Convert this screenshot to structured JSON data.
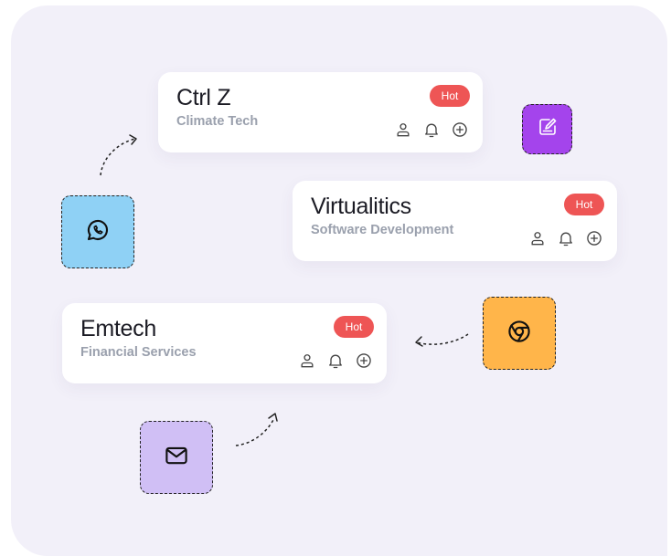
{
  "cards": [
    {
      "title": "Ctrl Z",
      "subtitle": "Climate Tech",
      "badge": "Hot",
      "actions": [
        "user-icon",
        "bell-icon",
        "plus-circle-icon"
      ]
    },
    {
      "title": "Virtualitics",
      "subtitle": "Software Development",
      "badge": "Hot",
      "actions": [
        "user-icon",
        "bell-icon",
        "plus-circle-icon"
      ]
    },
    {
      "title": "Emtech",
      "subtitle": "Financial Services",
      "badge": "Hot",
      "actions": [
        "user-icon",
        "bell-icon",
        "plus-circle-icon"
      ]
    }
  ],
  "tiles": [
    {
      "icon": "whatsapp-icon",
      "color": "#8fd1f5"
    },
    {
      "icon": "chrome-icon",
      "color": "#ffb54a"
    },
    {
      "icon": "mail-icon",
      "color": "#d0bff5"
    },
    {
      "icon": "edit-note-icon",
      "color": "#a444ec"
    }
  ],
  "colors": {
    "background": "#f2f0f9",
    "card": "#ffffff",
    "badge": "#ee5555",
    "title": "#1b1b24",
    "subtitle": "#9aa0ad"
  }
}
